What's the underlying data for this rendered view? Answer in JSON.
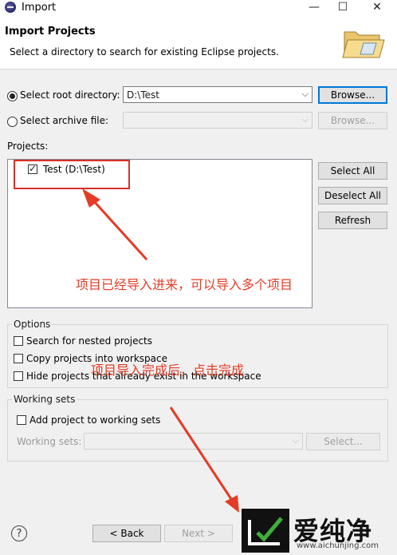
{
  "window": {
    "title": "Import",
    "minimize_glyph": "—",
    "maximize_glyph": "☐",
    "close_glyph": "✕"
  },
  "header": {
    "title": "Import Projects",
    "description": "Select a directory to search for existing Eclipse projects."
  },
  "root_directory": {
    "label": "Select root directory:",
    "selected": true,
    "value": "D:\\Test",
    "browse_label": "Browse..."
  },
  "archive_file": {
    "label": "Select archive file:",
    "selected": false,
    "value": "",
    "browse_label": "Browse..."
  },
  "projects": {
    "label": "Projects:",
    "items": [
      {
        "label": "Test (D:\\Test)",
        "checked": true
      }
    ],
    "select_all_label": "Select All",
    "deselect_all_label": "Deselect All",
    "refresh_label": "Refresh"
  },
  "options": {
    "title": "Options",
    "items": [
      {
        "label": "Search for nested projects",
        "checked": false
      },
      {
        "label": "Copy projects into workspace",
        "checked": false
      },
      {
        "label": "Hide projects that already exist in the workspace",
        "checked": false
      }
    ]
  },
  "working_sets": {
    "title": "Working sets",
    "add_label": "Add project to working sets",
    "add_checked": false,
    "field_label": "Working sets:",
    "value": "",
    "select_label": "Select..."
  },
  "footer": {
    "help_glyph": "?",
    "back_label": "< Back",
    "next_label": "Next >"
  },
  "annotations": {
    "projects_note": "项目已经导入进来，可以导入多个项目",
    "finish_note": "项目导入完成后，点击完成",
    "color": "#e43c26"
  },
  "watermark": {
    "brand": "爱纯净",
    "url": "www.aichunjing.com"
  },
  "colors": {
    "accent": "#0078d7",
    "highlight_box": "#d9302a"
  }
}
